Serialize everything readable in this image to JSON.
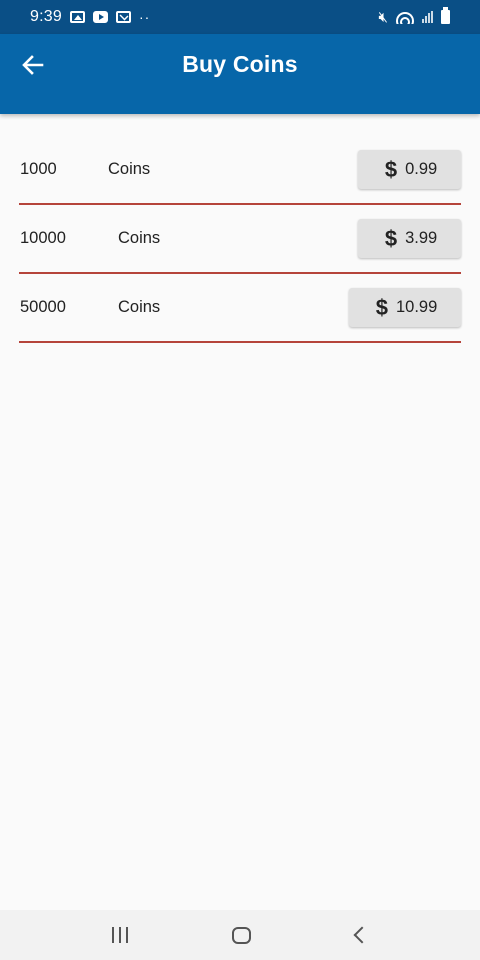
{
  "status_bar": {
    "time": "9:39",
    "left_icons": [
      "photo-icon",
      "youtube-icon",
      "mail-icon"
    ],
    "dots": "··",
    "right_icons": [
      "mute-icon",
      "wifi-icon",
      "signal-icon",
      "battery-icon"
    ]
  },
  "app_bar": {
    "back_icon": "arrow-left-icon",
    "title": "Buy Coins",
    "color": "#0766a9"
  },
  "coin_packages": [
    {
      "amount": "1000",
      "label": "Coins",
      "currency_icon": "dollar-icon",
      "price": "0.99"
    },
    {
      "amount": "10000",
      "label": "Coins",
      "currency_icon": "dollar-icon",
      "price": "3.99"
    },
    {
      "amount": "50000",
      "label": "Coins",
      "currency_icon": "dollar-icon",
      "price": "10.99"
    }
  ],
  "divider_color": "#b5443a",
  "nav_bar": {
    "buttons": [
      "recent-apps-icon",
      "home-icon",
      "back-icon"
    ]
  }
}
